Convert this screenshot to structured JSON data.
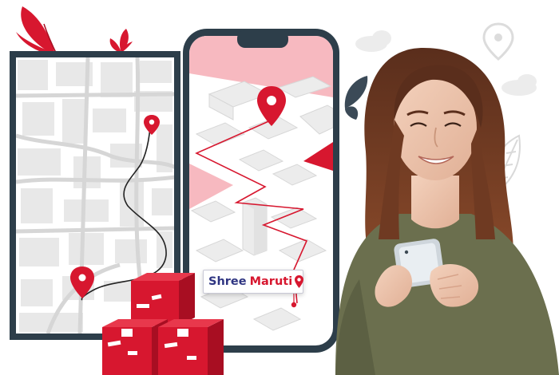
{
  "brand": {
    "name_part1": "Shree",
    "name_part2": "Maruti"
  },
  "icons": {
    "pin": "map-pin-icon",
    "leaf": "leaf-icon",
    "cloud": "cloud-icon",
    "box": "parcel-box-icon",
    "phone": "smartphone-icon"
  },
  "colors": {
    "brand_red": "#d7172f",
    "brand_navy": "#2f3582",
    "map_gray": "#e9e9e9",
    "phone_frame": "#2d3e4a",
    "map_pink": "#f7b9c0"
  }
}
